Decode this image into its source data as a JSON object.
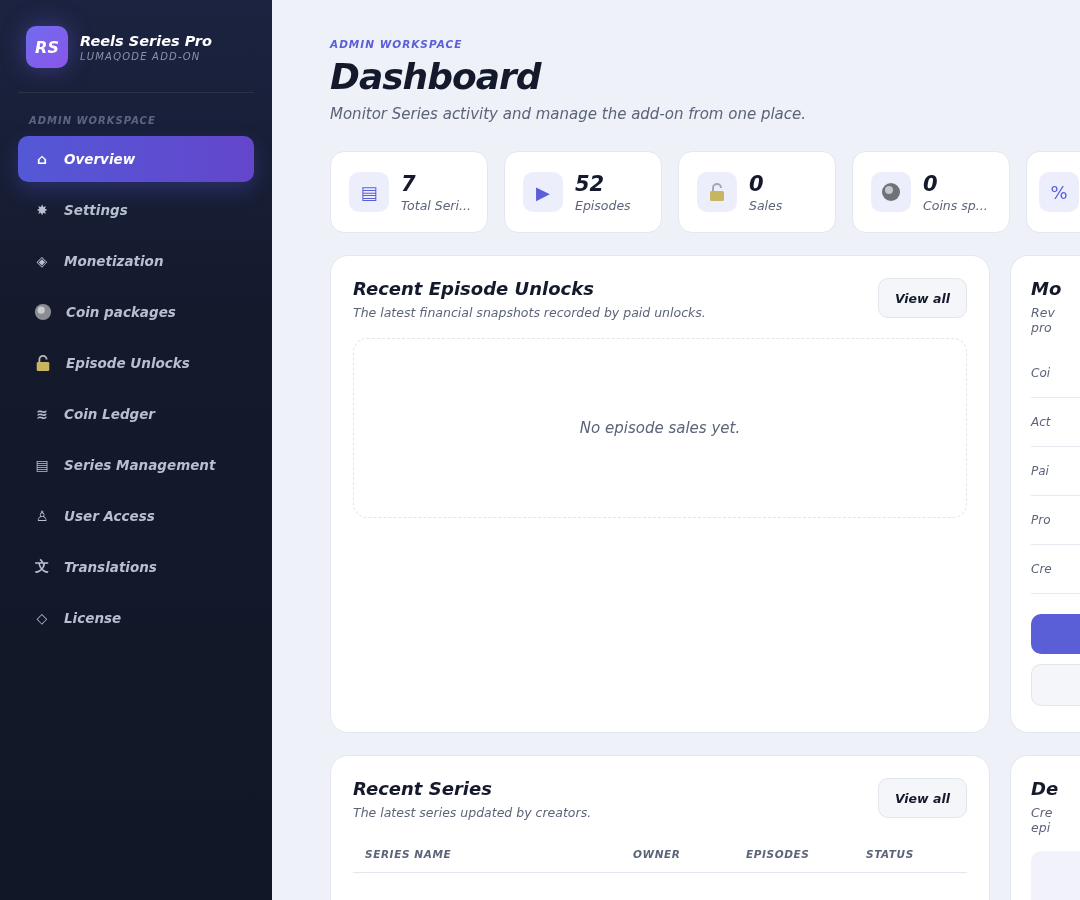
{
  "brand": {
    "initials": "RS",
    "name": "Reels Series Pro",
    "subtitle": "LUMAQODE ADD-ON"
  },
  "sidebar": {
    "section": "ADMIN WORKSPACE",
    "items": [
      {
        "label": "Overview",
        "kind": "glyph",
        "icon": "⌂",
        "selected": true
      },
      {
        "label": "Settings",
        "kind": "glyph",
        "icon": "✸",
        "selected": false
      },
      {
        "label": "Monetization",
        "kind": "glyph",
        "icon": "◈",
        "selected": false
      },
      {
        "label": "Coin packages",
        "kind": "coin",
        "selected": false
      },
      {
        "label": "Episode Unlocks",
        "kind": "lock",
        "selected": false
      },
      {
        "label": "Coin Ledger",
        "kind": "glyph",
        "icon": "≋",
        "selected": false
      },
      {
        "label": "Series Management",
        "kind": "glyph",
        "icon": "▤",
        "selected": false
      },
      {
        "label": "User Access",
        "kind": "glyph",
        "icon": "♙",
        "selected": false
      },
      {
        "label": "Translations",
        "kind": "glyph",
        "icon": "文",
        "selected": false
      },
      {
        "label": "License",
        "kind": "glyph",
        "icon": "◇",
        "selected": false
      }
    ]
  },
  "header": {
    "eyebrow": "ADMIN WORKSPACE",
    "title": "Dashboard",
    "subtitle": "Monitor Series activity and manage the add-on from one place."
  },
  "stats": [
    {
      "kind": "glyph",
      "icon": "▤",
      "value": "7",
      "label": "Total Seri..."
    },
    {
      "kind": "glyph",
      "icon": "▶",
      "value": "52",
      "label": "Episodes"
    },
    {
      "kind": "lock",
      "value": "0",
      "label": "Sales"
    },
    {
      "kind": "coin",
      "value": "0",
      "label": "Coins sp..."
    },
    {
      "kind": "glyph",
      "icon": "%"
    }
  ],
  "unlocks": {
    "title": "Recent Episode Unlocks",
    "subtitle": "The latest financial snapshots recorded by paid unlocks.",
    "button": "View all",
    "empty": "No episode sales yet."
  },
  "side_panel": {
    "title": "Mo",
    "description": [
      "Rev",
      "pro"
    ],
    "rows": [
      "Coi",
      "Act",
      "Pai",
      "Pro",
      "Cre"
    ]
  },
  "recent_series": {
    "title": "Recent Series",
    "subtitle": "The latest series updated by creators.",
    "button": "View all",
    "columns": [
      "SERIES NAME",
      "OWNER",
      "EPISODES",
      "STATUS"
    ]
  },
  "side_panel_2": {
    "title": "De",
    "description": [
      "Cre",
      "epi"
    ]
  }
}
